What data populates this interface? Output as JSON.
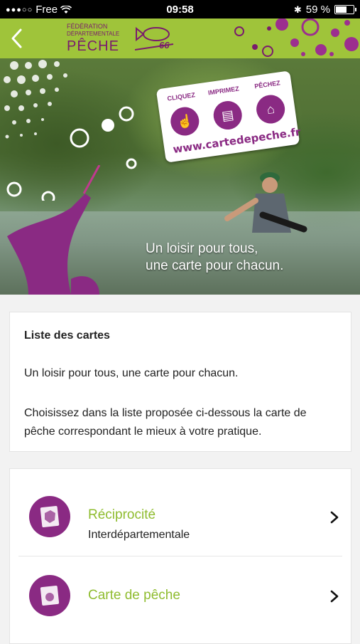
{
  "status_bar": {
    "carrier": "Free",
    "time": "09:58",
    "battery": "59 %",
    "battery_level": 0.59
  },
  "header": {
    "logo": {
      "line1": "FÉDÉRATION",
      "line2": "DÉPARTEMENTALE",
      "line3": "PÊCHE",
      "number": "66"
    },
    "accent_color": "#9fc43a"
  },
  "hero": {
    "badge": {
      "labels": [
        "CLIQUEZ",
        "IMPRIMEZ",
        "PÊCHEZ"
      ],
      "url": "www.cartedepeche.fr"
    },
    "caption_line1": "Un loisir pour tous,",
    "caption_line2": "une carte pour chacun."
  },
  "info_card": {
    "title": "Liste des cartes",
    "paragraph1": "Un loisir pour tous, une carte pour chacun.",
    "paragraph2": "Choisissez dans la liste proposée ci-dessous la carte de pêche correspondant le mieux à votre pratique."
  },
  "card_list": {
    "items": [
      {
        "name": "Réciprocité",
        "subtitle": "Interdépartementale",
        "icon": "france-map-icon"
      },
      {
        "name": "Carte de pêche",
        "subtitle": "",
        "icon": "fishing-card-icon"
      }
    ]
  },
  "colors": {
    "brand_purple": "#8a2a83",
    "brand_green": "#9fc43a",
    "item_title_green": "#8fbc2f"
  }
}
